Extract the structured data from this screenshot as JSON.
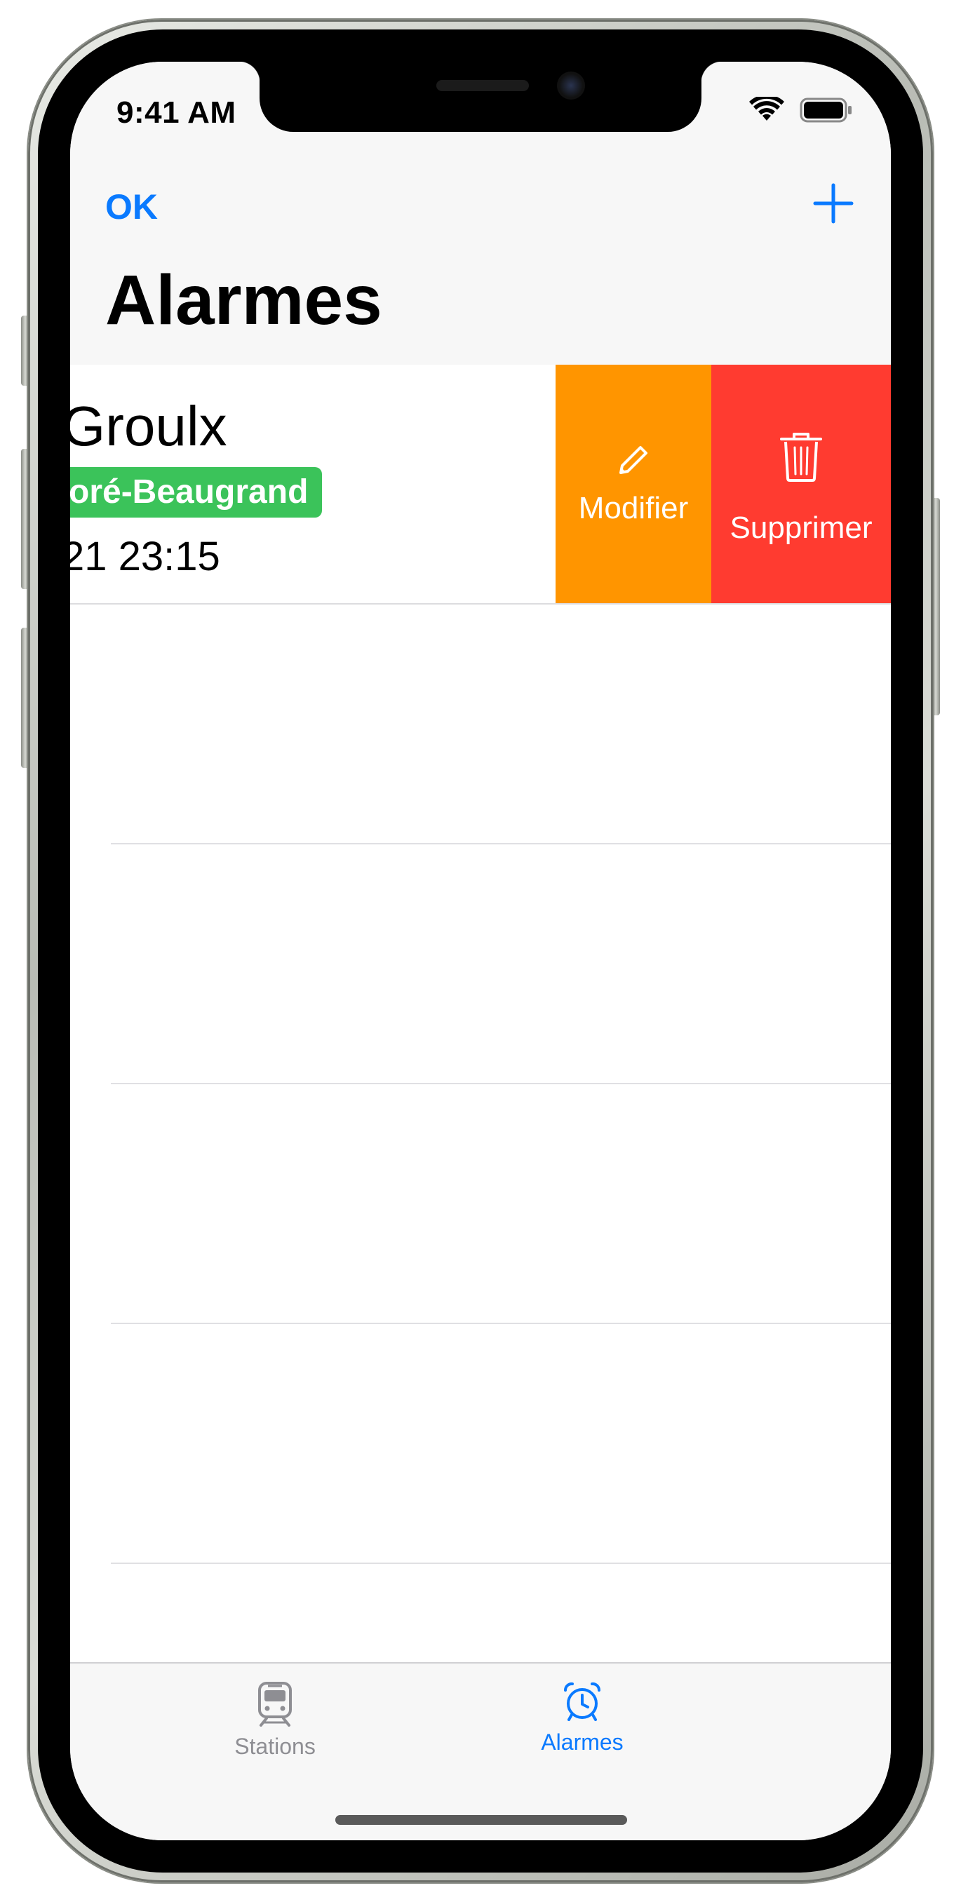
{
  "status_bar": {
    "time": "9:41 AM"
  },
  "nav": {
    "ok_label": "OK",
    "title": "Alarmes",
    "add_icon": "plus-icon"
  },
  "alarm_row": {
    "station": "Groulx",
    "line": "oré-Beaugrand",
    "datetime": "21 23:15",
    "line_color": "#3bc35a",
    "actions": {
      "edit_label": "Modifier",
      "delete_label": "Supprimer",
      "edit_color": "#ff9500",
      "delete_color": "#ff3b30"
    }
  },
  "tab_bar": {
    "tabs": [
      {
        "label": "Stations",
        "icon": "train-icon",
        "selected": false
      },
      {
        "label": "Alarmes",
        "icon": "alarm-clock-icon",
        "selected": true
      }
    ]
  },
  "colors": {
    "accent": "#0a7aff",
    "inactive": "#8e8e93"
  }
}
